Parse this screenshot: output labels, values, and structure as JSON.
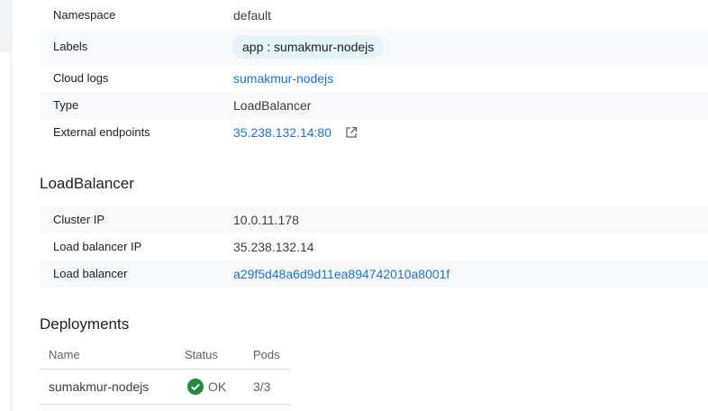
{
  "details": {
    "rows": [
      {
        "label": "Namespace",
        "value": "default"
      },
      {
        "label": "Labels",
        "value": "app : sumakmur-nodejs"
      },
      {
        "label": "Cloud logs",
        "value": "sumakmur-nodejs"
      },
      {
        "label": "Type",
        "value": "LoadBalancer"
      },
      {
        "label": "External endpoints",
        "value": "35.238.132.14:80"
      }
    ]
  },
  "load_balancer": {
    "title": "LoadBalancer",
    "rows": [
      {
        "label": "Cluster IP",
        "value": "10.0.11.178"
      },
      {
        "label": "Load balancer IP",
        "value": "35.238.132.14"
      },
      {
        "label": "Load balancer",
        "value": "a29f5d48a6d9d11ea894742010a8001f"
      }
    ]
  },
  "deployments": {
    "title": "Deployments",
    "columns": {
      "name": "Name",
      "status": "Status",
      "pods": "Pods"
    },
    "rows": [
      {
        "name": "sumakmur-nodejs",
        "status": "OK",
        "pods": "3/3"
      }
    ]
  },
  "icons": {
    "external_link": "external-link-icon",
    "status_ok": "check-circle-icon"
  },
  "colors": {
    "link": "#1a73e8",
    "ok_green": "#1e8e3e",
    "chip_bg": "#e4f4fb",
    "row_shade": "#f8f9fa"
  }
}
